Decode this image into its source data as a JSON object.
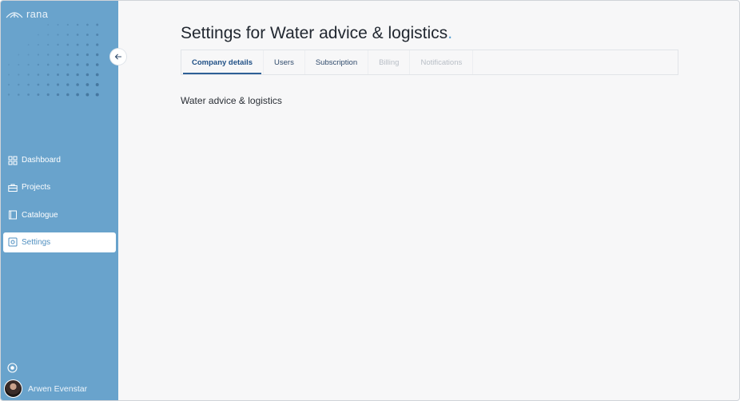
{
  "sidebar": {
    "logo_text": "rana",
    "collapse_icon": "arrow-left-icon",
    "items": [
      {
        "label": "Dashboard",
        "icon": "grid-icon",
        "active": false
      },
      {
        "label": "Projects",
        "icon": "briefcase-icon",
        "active": false
      },
      {
        "label": "Catalogue",
        "icon": "book-icon",
        "active": false
      },
      {
        "label": "Settings",
        "icon": "settings-icon",
        "active": true
      }
    ],
    "help_icon": "circle-icon",
    "user": {
      "name": "Arwen Evenstar"
    }
  },
  "main": {
    "title": "Settings for Water advice & logistics",
    "title_dot": ".",
    "tabs": [
      {
        "label": "Company details",
        "active": true,
        "disabled": false
      },
      {
        "label": "Users",
        "active": false,
        "disabled": false
      },
      {
        "label": "Subscription",
        "active": false,
        "disabled": false
      },
      {
        "label": "Billing",
        "active": false,
        "disabled": true
      },
      {
        "label": "Notifications",
        "active": false,
        "disabled": true
      }
    ],
    "company_name": "Water advice & logistics"
  },
  "colors": {
    "sidebar_bg": "#69a3cc",
    "accent": "#2e5f96",
    "title_dot": "#5aa0d2",
    "background": "#f7f7f8"
  }
}
